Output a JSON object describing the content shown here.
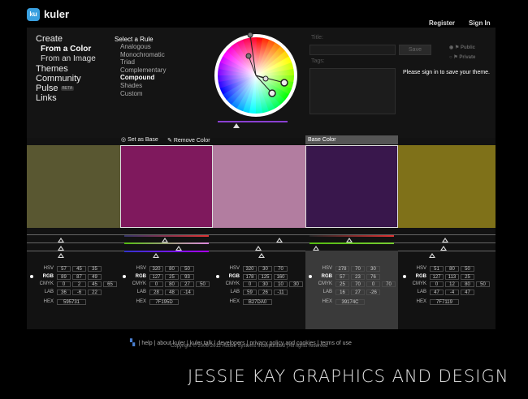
{
  "app": {
    "logo_badge": "ku",
    "logo_text": "kuler"
  },
  "header": {
    "register": "Register",
    "signin": "Sign In"
  },
  "nav": {
    "create": "Create",
    "from_color": "From a Color",
    "from_image": "From an Image",
    "themes": "Themes",
    "community": "Community",
    "pulse": "Pulse",
    "pulse_badge": "BETA",
    "links": "Links"
  },
  "rules": {
    "heading": "Select a Rule",
    "items": [
      "Analogous",
      "Monochromatic",
      "Triad",
      "Complementary",
      "Compound",
      "Shades",
      "Custom"
    ],
    "active": "Compound"
  },
  "form": {
    "title_label": "Title:",
    "tags_label": "Tags:",
    "save": "Save",
    "public": "Public",
    "private": "Private",
    "signin_msg": "Please sign in to save your theme."
  },
  "toolbar": {
    "set_base": "Set as Base",
    "remove": "Remove Color",
    "base_tab": "Base Color"
  },
  "swatches": [
    {
      "hex": "595731",
      "hsv": [
        "57",
        "45",
        "35"
      ],
      "rgb": [
        "89",
        "87",
        "49"
      ],
      "cmyk": [
        "0",
        "2",
        "45",
        "65"
      ],
      "lab": [
        "36",
        "-6",
        "22"
      ],
      "color": "#595731"
    },
    {
      "hex": "7F195D",
      "hsv": [
        "320",
        "80",
        "50"
      ],
      "rgb": [
        "127",
        "25",
        "93"
      ],
      "cmyk": [
        "0",
        "80",
        "27",
        "50"
      ],
      "lab": [
        "28",
        "48",
        "-14"
      ],
      "color": "#7F195D"
    },
    {
      "hex": "B27DA0",
      "hsv": [
        "320",
        "30",
        "70"
      ],
      "rgb": [
        "178",
        "125",
        "160"
      ],
      "cmyk": [
        "0",
        "30",
        "10",
        "30"
      ],
      "lab": [
        "59",
        "26",
        "-11"
      ],
      "color": "#B27DA0"
    },
    {
      "hex": "39174C",
      "hsv": [
        "278",
        "70",
        "30"
      ],
      "rgb": [
        "57",
        "23",
        "76"
      ],
      "cmyk": [
        "25",
        "70",
        "0",
        "70"
      ],
      "lab": [
        "16",
        "27",
        "-26"
      ],
      "color": "#39174C"
    },
    {
      "hex": "7F7119",
      "hsv": [
        "51",
        "80",
        "50"
      ],
      "rgb": [
        "127",
        "113",
        "25"
      ],
      "cmyk": [
        "0",
        "12",
        "80",
        "50"
      ],
      "lab": [
        "47",
        "-4",
        "47"
      ],
      "color": "#7F7119"
    }
  ],
  "labels": {
    "hsv": "HSV",
    "rgb": "RGB",
    "cmyk": "CMYK",
    "lab": "LAB",
    "hex": "HEX"
  },
  "footer": {
    "links": [
      "help",
      "about kuler",
      "kuler talk",
      "developers",
      "privacy policy and cookies",
      "terms of use"
    ],
    "copyright": "Copyright © 2006-2012 Adobe Systems Incorporated | All rights reserved"
  },
  "watermark": "JESSIE KAY GRAPHICS AND DESIGN",
  "colors": {
    "bg": "#000000",
    "panel": "#121212",
    "accent": "#8a3fd1"
  }
}
